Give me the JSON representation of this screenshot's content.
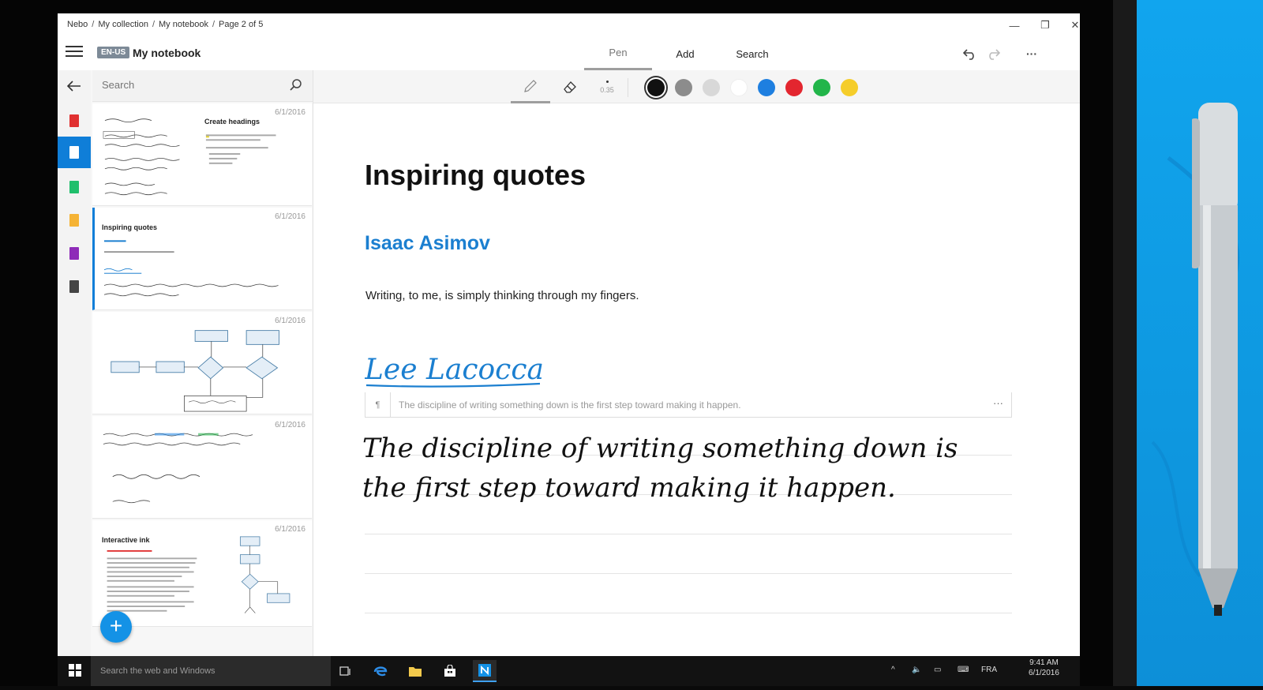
{
  "window": {
    "breadcrumb": [
      "Nebo",
      "My collection",
      "My notebook",
      "Page 2 of 5"
    ],
    "controls": {
      "minimize": "—",
      "restore": "❐",
      "close": "✕"
    }
  },
  "appbar": {
    "language": "EN-US",
    "notebook_title": "My notebook",
    "tabs": [
      {
        "label": "Pen",
        "active": true
      },
      {
        "label": "Add",
        "active": false
      },
      {
        "label": "Search",
        "active": false
      }
    ],
    "undo_icon": "undo-icon",
    "redo_icon": "redo-icon",
    "more_label": "···"
  },
  "sidebar": {
    "back_icon": "arrow-left-icon",
    "sections": [
      {
        "color": "#e03131",
        "active": false
      },
      {
        "color": "#ffffff",
        "active": true
      },
      {
        "color": "#1fbf6c",
        "active": false
      },
      {
        "color": "#f5b335",
        "active": false
      },
      {
        "color": "#8e2bb8",
        "active": false
      },
      {
        "color": "#444444",
        "active": false
      }
    ]
  },
  "pagelist": {
    "search_placeholder": "Search",
    "pages": [
      {
        "date": "6/1/2016",
        "title": "Create headings",
        "active": false
      },
      {
        "date": "6/1/2016",
        "title": "Inspiring quotes",
        "active": true
      },
      {
        "date": "6/1/2016",
        "title": "",
        "active": false
      },
      {
        "date": "6/1/2016",
        "title": "",
        "active": false
      },
      {
        "date": "6/1/2016",
        "title": "Interactive ink",
        "active": false
      }
    ],
    "add_label": "+"
  },
  "pen_toolbar": {
    "thickness": "0.35",
    "colors": [
      {
        "name": "black",
        "hex": "#111111",
        "selected": true
      },
      {
        "name": "gray",
        "hex": "#8c8c8c",
        "selected": false
      },
      {
        "name": "light-gray",
        "hex": "#d8d8d8",
        "selected": false
      },
      {
        "name": "white",
        "hex": "#ffffff",
        "selected": false
      },
      {
        "name": "blue",
        "hex": "#1e7fe0",
        "selected": false
      },
      {
        "name": "red",
        "hex": "#e3262f",
        "selected": false
      },
      {
        "name": "green",
        "hex": "#22b54a",
        "selected": false
      },
      {
        "name": "yellow",
        "hex": "#f5cd2a",
        "selected": false
      }
    ]
  },
  "document": {
    "title": "Inspiring quotes",
    "heading1": "Isaac Asimov",
    "quote1": "Writing, to me, is simply thinking through my fingers.",
    "handwritten_heading": "Lee Lacocca",
    "conversion_preview": "The discipline of writing something down is the first step toward making it happen.",
    "conversion_more": "···",
    "handwritten_line1": "The discipline of writing something down is",
    "handwritten_line2": "the first step toward making it happen."
  },
  "taskbar": {
    "search_placeholder": "Search the web and Windows",
    "language": "FRA",
    "time": "9:41 AM",
    "date": "6/1/2016"
  }
}
